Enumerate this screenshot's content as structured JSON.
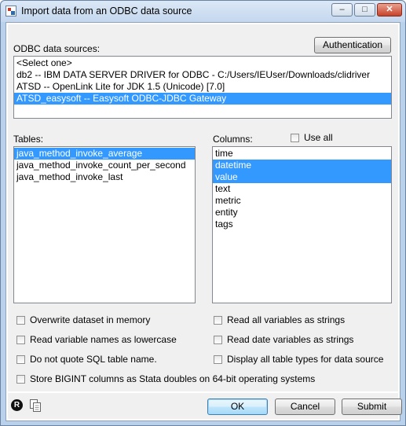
{
  "window": {
    "title": "Import data from an ODBC data source",
    "controls": {
      "minimize": "–",
      "maximize": "□",
      "close": "✕"
    },
    "icon": "stata-icon"
  },
  "sources": {
    "label": "ODBC data sources:",
    "auth_button": "Authentication",
    "items": [
      {
        "text": "<Select one>",
        "selected": false
      },
      {
        "text": "db2 -- IBM DATA SERVER DRIVER for ODBC - C:/Users/IEUser/Downloads/clidriver",
        "selected": false
      },
      {
        "text": "ATSD -- OpenLink Lite for JDK 1.5 (Unicode) [7.0]",
        "selected": false
      },
      {
        "text": "ATSD_easysoft -- Easysoft ODBC-JDBC Gateway",
        "selected": true
      }
    ]
  },
  "tables": {
    "label": "Tables:",
    "items": [
      {
        "text": "java_method_invoke_average",
        "selected": true
      },
      {
        "text": "java_method_invoke_count_per_second",
        "selected": false
      },
      {
        "text": "java_method_invoke_last",
        "selected": false
      }
    ]
  },
  "columns": {
    "label": "Columns:",
    "use_all_label": "Use all",
    "use_all_checked": false,
    "items": [
      {
        "text": "time",
        "selected": false
      },
      {
        "text": "datetime",
        "selected": true
      },
      {
        "text": "value",
        "selected": true
      },
      {
        "text": "text",
        "selected": false
      },
      {
        "text": "metric",
        "selected": false
      },
      {
        "text": "entity",
        "selected": false
      },
      {
        "text": "tags",
        "selected": false
      }
    ]
  },
  "options": {
    "overwrite": "Overwrite dataset in memory",
    "read_all_strings": "Read all variables as strings",
    "lowercase": "Read variable names as lowercase",
    "date_strings": "Read date variables as strings",
    "no_quote": "Do not quote SQL table name.",
    "all_table_types": "Display all table types for data source",
    "bigint": "Store BIGINT columns as Stata doubles on 64-bit operating systems"
  },
  "footer": {
    "help_icon": "R",
    "copy_icon": "copy-icon",
    "ok": "OK",
    "cancel": "Cancel",
    "submit": "Submit"
  }
}
